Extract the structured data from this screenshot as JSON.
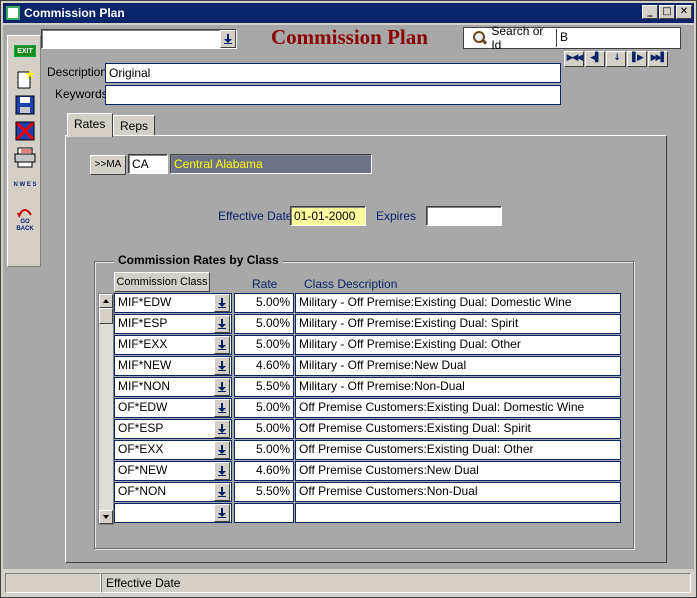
{
  "window": {
    "title": "Commission Plan",
    "controls": [
      "_",
      "□",
      "✕"
    ]
  },
  "toolbar": {
    "exit_label": "EXIT",
    "go_back_label": "GO BACK",
    "wheel_label": "N W E S"
  },
  "header": {
    "app_title": "Commission Plan",
    "search_label": "Search or Id",
    "search_value": "B",
    "top_dropdown_value": ""
  },
  "form": {
    "description_label": "Description",
    "description_value": "Original",
    "keywords_label": "Keywords",
    "keywords_value": ""
  },
  "tabs": [
    {
      "label": "Rates",
      "active": true
    },
    {
      "label": "Reps",
      "active": false
    }
  ],
  "rates": {
    "ma_button": ">>MA",
    "ma_code": "CA",
    "ma_name": "Central Alabama",
    "effective_date_label": "Effective Date",
    "effective_date_value": "01-01-2000",
    "expires_label": "Expires",
    "expires_value": "",
    "group_title": "Commission Rates by Class",
    "col_class_button": "Commission Class",
    "col_rate": "Rate",
    "col_desc": "Class Description",
    "rows": [
      {
        "cls": "MIF*EDW",
        "rate": "5.00%",
        "desc": "Military - Off Premise:Existing Dual: Domestic Wine"
      },
      {
        "cls": "MIF*ESP",
        "rate": "5.00%",
        "desc": "Military - Off Premise:Existing Dual: Spirit"
      },
      {
        "cls": "MIF*EXX",
        "rate": "5.00%",
        "desc": "Military - Off Premise:Existing Dual: Other"
      },
      {
        "cls": "MIF*NEW",
        "rate": "4.60%",
        "desc": "Military - Off Premise:New Dual"
      },
      {
        "cls": "MIF*NON",
        "rate": "5.50%",
        "desc": "Military - Off Premise:Non-Dual"
      },
      {
        "cls": "OF*EDW",
        "rate": "5.00%",
        "desc": "Off Premise Customers:Existing Dual: Domestic Wine"
      },
      {
        "cls": "OF*ESP",
        "rate": "5.00%",
        "desc": "Off Premise Customers:Existing Dual: Spirit"
      },
      {
        "cls": "OF*EXX",
        "rate": "5.00%",
        "desc": "Off Premise Customers:Existing Dual: Other"
      },
      {
        "cls": "OF*NEW",
        "rate": "4.60%",
        "desc": "Off Premise Customers:New Dual"
      },
      {
        "cls": "OF*NON",
        "rate": "5.50%",
        "desc": "Off Premise Customers:Non-Dual"
      },
      {
        "cls": "",
        "rate": "",
        "desc": ""
      }
    ]
  },
  "status": {
    "text": "Effective Date"
  },
  "colors": {
    "title_bar": "#0a246a",
    "app_title": "#8b0000",
    "ma_name_bg": "#6e7286",
    "ma_name_text": "#ffff00",
    "date_highlight": "#ffffa0"
  }
}
